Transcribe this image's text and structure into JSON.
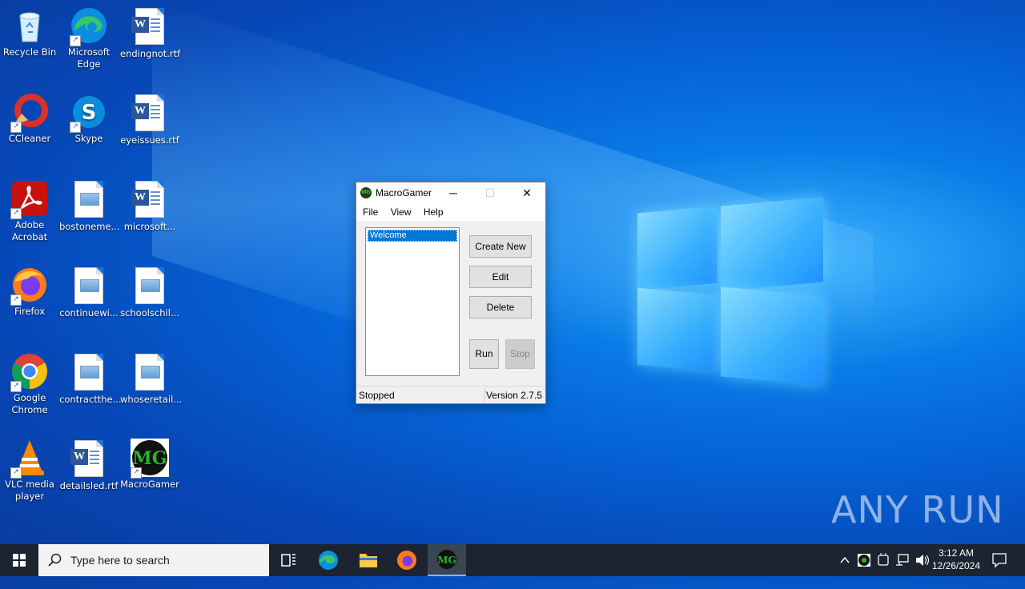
{
  "desktop": {
    "icons": [
      {
        "label": "Recycle Bin",
        "icon": "recycle-bin-icon"
      },
      {
        "label": "Microsoft Edge",
        "icon": "edge-icon"
      },
      {
        "label": "endingnot.rtf",
        "icon": "word-document-icon"
      },
      {
        "label": "CCleaner",
        "icon": "ccleaner-icon"
      },
      {
        "label": "Skype",
        "icon": "skype-icon"
      },
      {
        "label": "eyeissues.rtf",
        "icon": "word-document-icon"
      },
      {
        "label": "Adobe Acrobat",
        "icon": "acrobat-icon"
      },
      {
        "label": "bostoneme...",
        "icon": "image-file-icon"
      },
      {
        "label": "microsoft...",
        "icon": "word-document-icon"
      },
      {
        "label": "Firefox",
        "icon": "firefox-icon"
      },
      {
        "label": "continuewi...",
        "icon": "image-file-icon"
      },
      {
        "label": "schoolschil...",
        "icon": "image-file-icon"
      },
      {
        "label": "Google Chrome",
        "icon": "chrome-icon"
      },
      {
        "label": "contractthe...",
        "icon": "image-file-icon"
      },
      {
        "label": "whoseretail...",
        "icon": "image-file-icon"
      },
      {
        "label": "VLC media player",
        "icon": "vlc-icon"
      },
      {
        "label": "detailsled.rtf",
        "icon": "word-document-icon"
      },
      {
        "label": "MacroGamer",
        "icon": "macrogamer-icon"
      }
    ]
  },
  "window": {
    "title": "MacroGamer",
    "app_icon_text": "MG",
    "controls": {
      "minimize": "─",
      "maximize": "☐",
      "close": "✕"
    },
    "menu": [
      "File",
      "View",
      "Help"
    ],
    "list_items": [
      "Welcome"
    ],
    "buttons": {
      "create_new": "Create New",
      "edit": "Edit",
      "delete": "Delete",
      "run": "Run",
      "stop": "Stop"
    },
    "status": {
      "state": "Stopped",
      "version": "Version 2.7.5"
    }
  },
  "watermark": "ANY RUN",
  "taskbar": {
    "search_placeholder": "Type here to search",
    "time": "3:12 AM",
    "date": "12/26/2024"
  }
}
